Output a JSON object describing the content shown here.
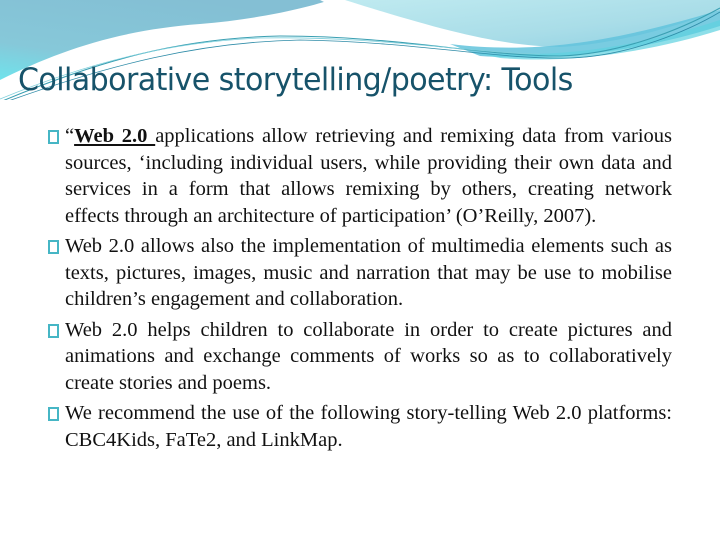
{
  "slide": {
    "title": "Collaborative storytelling/poetry: Tools",
    "colors": {
      "title": "#17536a",
      "bullet": "#46b6c5",
      "wave_dark": "#7fc0d6",
      "wave_light": "#b3e3ea",
      "wave_cyan": "#6fdbe6"
    },
    "bullets": [
      {
        "icon": "hollow-square-bullet",
        "prefix": "“",
        "emphasis": "Web 2.0 ",
        "text": "applications allow retrieving and remixing data from various sources, ‘including individual users, while providing their own data and services in a form that allows remixing by others, creating network effects through an architecture of participation’ (O’Reilly, 2007)."
      },
      {
        "icon": "hollow-square-bullet",
        "text": "Web 2.0 allows also the implementation of multimedia elements such as texts, pictures, images, music and narration that may be use to mobilise children’s engagement and collaboration."
      },
      {
        "icon": "hollow-square-bullet",
        "text": "Web 2.0 helps children to collaborate in order to create pictures and animations and exchange comments of works so as to collaboratively create stories and poems."
      },
      {
        "icon": "hollow-square-bullet",
        "text": "We recommend the use of the following story-telling Web 2.0 platforms: CBC4Kids, FaTe2, and LinkMap."
      }
    ]
  }
}
